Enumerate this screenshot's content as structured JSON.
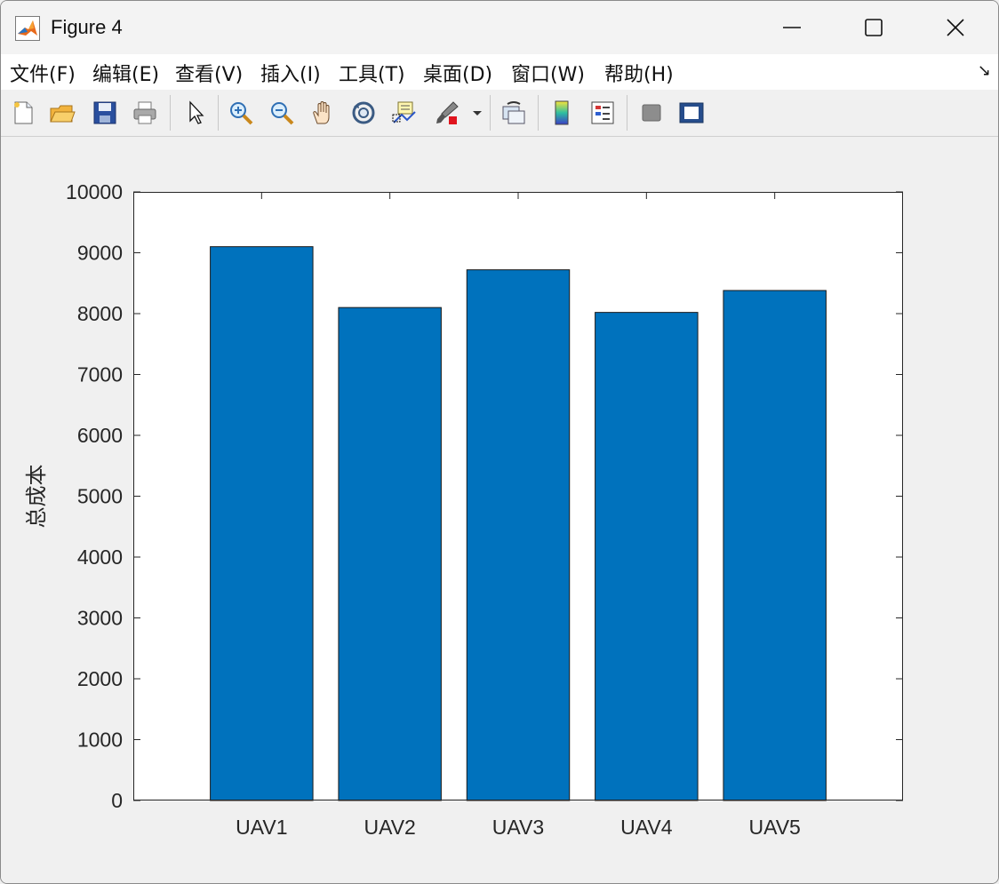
{
  "window": {
    "title": "Figure 4",
    "icon": "matlab-icon"
  },
  "controls": {
    "minimize": "minimize-icon",
    "maximize": "maximize-icon",
    "close": "close-icon"
  },
  "menubar": {
    "items": [
      "文件(F)",
      "编辑(E)",
      "查看(V)",
      "插入(I)",
      "工具(T)",
      "桌面(D)",
      "窗口(W)",
      "帮助(H)"
    ],
    "expand_icon": "dock-arrow-icon"
  },
  "toolbar": {
    "items": [
      "new-figure-icon",
      "open-file-icon",
      "save-icon",
      "print-icon",
      "pointer-icon",
      "zoom-in-icon",
      "zoom-out-icon",
      "pan-icon",
      "rotate-3d-icon",
      "data-cursor-icon",
      "brush-icon",
      "link-plot-icon",
      "insert-colorbar-icon",
      "insert-legend-icon",
      "hide-plot-tools-icon",
      "show-plot-tools-icon"
    ]
  },
  "colors": {
    "bar": "#0072bd",
    "axes_bg": "#ffffff",
    "figure_bg": "#f0f0f0"
  },
  "chart_data": {
    "type": "bar",
    "categories": [
      "UAV1",
      "UAV2",
      "UAV3",
      "UAV4",
      "UAV5"
    ],
    "values": [
      9100,
      8100,
      8720,
      8020,
      8380
    ],
    "title": "",
    "xlabel": "",
    "ylabel": "总成本",
    "ylim": [
      0,
      10000
    ],
    "yticks": [
      "0",
      "1000",
      "2000",
      "3000",
      "4000",
      "5000",
      "6000",
      "7000",
      "8000",
      "9000",
      "10000"
    ],
    "grid": false,
    "legend": "none"
  }
}
